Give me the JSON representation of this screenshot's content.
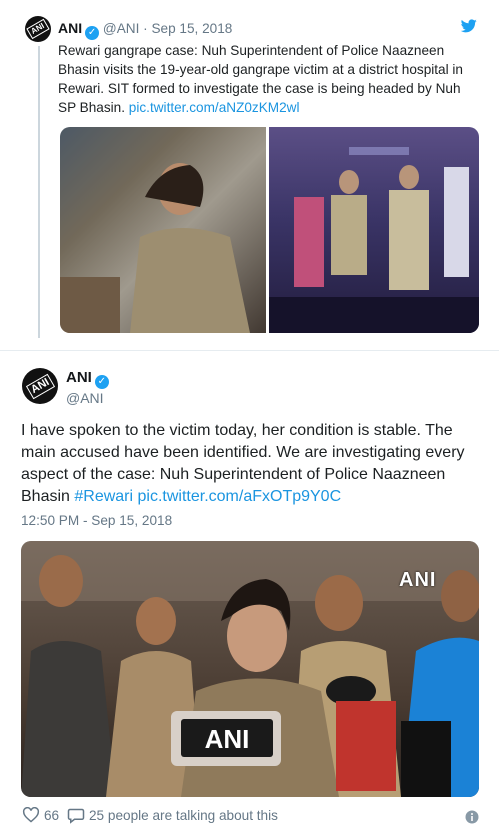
{
  "quoted_tweet": {
    "name": "ANI",
    "handle": "@ANI",
    "date": "Sep 15, 2018",
    "text": "Rewari gangrape case: Nuh Superintendent of Police Naazneen Bhasin visits the 19-year-old gangrape victim at a district hospital in Rewari. SIT formed to investigate the case is being headed by Nuh SP Bhasin.",
    "link": "pic.twitter.com/aNZ0zKM2wl"
  },
  "tweet": {
    "name": "ANI",
    "handle": "@ANI",
    "text": "I have spoken to the victim today, her condition is stable. The main accused have been identified. We are investigating every aspect of the case: Nuh Superintendent of Police Naazneen Bhasin",
    "hashtag": "#Rewari",
    "link": "pic.twitter.com/aFxOTp9Y0C",
    "timestamp": "12:50 PM - Sep 15, 2018",
    "media_watermark": "ANI",
    "mic_label": "ANI"
  },
  "footer": {
    "likes": "66",
    "talking": "25 people are talking about this"
  },
  "avatar_label": "ANI",
  "icons": [
    "twitter-bird-icon",
    "verified-badge-icon",
    "heart-icon",
    "reply-bubble-icon",
    "info-icon"
  ],
  "colors": {
    "link": "#1b95e0",
    "verified": "#1da1f2",
    "muted": "#657786"
  }
}
